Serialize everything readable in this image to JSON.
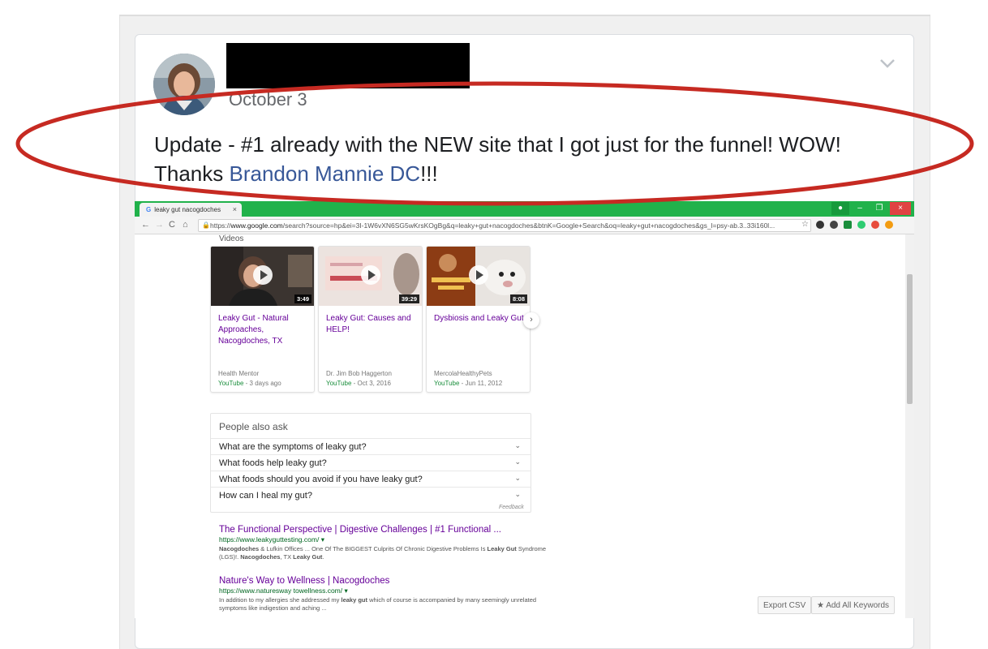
{
  "post": {
    "date": "October 3",
    "text_before": "Update - #1 already with the NEW site that I got just for the funnel! WOW! Thanks ",
    "mention": "Brandon Mannie DC",
    "text_after": "!!!"
  },
  "browser": {
    "tab_title": "leaky gut nacogdoches",
    "tab_close": "×",
    "url_prefix": "https://",
    "url_host": "www.google.com",
    "url_rest": "/search?source=hp&ei=3I-1W6vXN6SG5wKrsKOgBg&q=leaky+gut+nacogdoches&btnK=Google+Search&oq=leaky+gut+nacogdoches&gs_l=psy-ab.3..33i160l...",
    "window_controls": {
      "minimize": "–",
      "maximize": "❐",
      "close": "×"
    }
  },
  "serp": {
    "videos_label": "Videos",
    "videos": [
      {
        "title": "Leaky Gut - Natural Approaches, Nacogdoches, TX",
        "duration": "3:49",
        "channel": "Health Mentor",
        "source": "YouTube",
        "date": " - 3 days ago"
      },
      {
        "title": "Leaky Gut: Causes and HELP!",
        "duration": "39:29",
        "channel": "Dr. Jim Bob Haggerton",
        "source": "YouTube",
        "date": " - Oct 3, 2016"
      },
      {
        "title": "Dysbiosis and Leaky Gut",
        "duration": "8:08",
        "channel": "MercolaHealthyPets",
        "source": "YouTube",
        "date": " - Jun 11, 2012"
      }
    ],
    "people_also_ask": {
      "title": "People also ask",
      "questions": [
        "What are the symptoms of leaky gut?",
        "What foods help leaky gut?",
        "What foods should you avoid if you have leaky gut?",
        "How can I heal my gut?"
      ],
      "feedback": "Feedback"
    },
    "results": [
      {
        "title": "The Functional Perspective | Digestive Challenges | #1 Functional ...",
        "url": "https://www.leakyguttesting.com/",
        "snippet_html": "<b>Nacogdoches</b> & Lufkin Offices ... One Of The BIGGEST Culprits Of Chronic Digestive Problems Is <b>Leaky Gut</b> Syndrome (LGS)!. <b>Nacogdoches</b>, TX <b>Leaky Gut</b>."
      },
      {
        "title": "Nature's Way to Wellness | Nacogdoches",
        "url": "https://www.naturesway towellness.com/",
        "snippet_html": "In addition to my allergies she addressed my <b>leaky gut</b> which of course is accompanied by many seemingly unrelated symptoms like indigestion and aching ..."
      }
    ],
    "export_csv": "Export CSV",
    "add_all_keywords": "Add All Keywords"
  },
  "colors": {
    "chrome_green": "#21b24b",
    "mention_blue": "#385898",
    "highlight_red": "#c62a22",
    "visited_link": "#660099",
    "url_green": "#006621"
  }
}
